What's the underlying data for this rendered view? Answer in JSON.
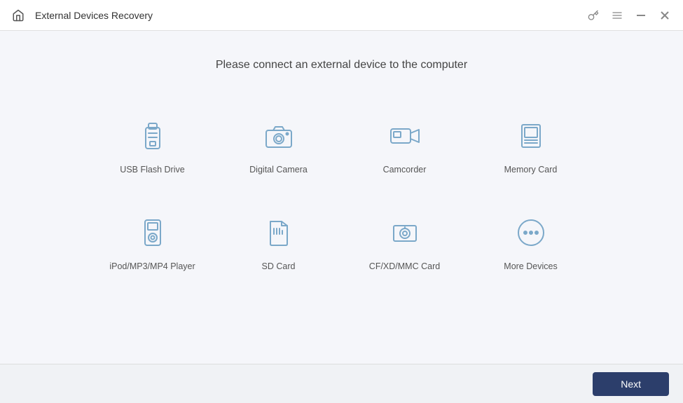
{
  "titlebar": {
    "title": "External Devices Recovery",
    "home_icon": "home",
    "key_icon": "key",
    "menu_icon": "menu",
    "minimize_icon": "minimize",
    "close_icon": "close"
  },
  "main": {
    "subtitle": "Please connect an external device to the computer",
    "devices": [
      {
        "id": "usb-flash-drive",
        "label": "USB Flash Drive"
      },
      {
        "id": "digital-camera",
        "label": "Digital Camera"
      },
      {
        "id": "camcorder",
        "label": "Camcorder"
      },
      {
        "id": "memory-card",
        "label": "Memory Card"
      },
      {
        "id": "ipod-player",
        "label": "iPod/MP3/MP4 Player"
      },
      {
        "id": "sd-card",
        "label": "SD Card"
      },
      {
        "id": "cf-card",
        "label": "CF/XD/MMC Card"
      },
      {
        "id": "more-devices",
        "label": "More Devices"
      }
    ]
  },
  "footer": {
    "next_label": "Next"
  }
}
